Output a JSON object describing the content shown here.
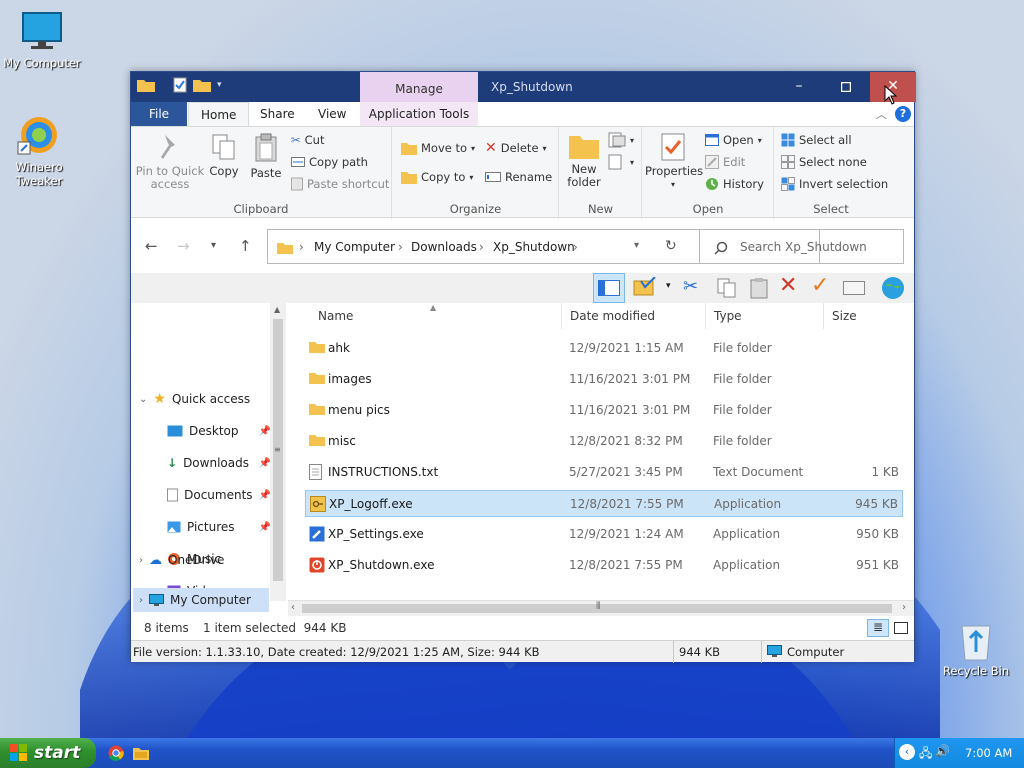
{
  "desktop": {
    "icons": [
      {
        "label": "My Computer"
      },
      {
        "label": "Winaero Tweaker"
      },
      {
        "label": "Recycle Bin"
      }
    ]
  },
  "window": {
    "title": "Xp_Shutdown",
    "context_tab": "Manage",
    "tabs": [
      "File",
      "Home",
      "Share",
      "View",
      "Application Tools"
    ],
    "ribbon": {
      "clipboard": {
        "label": "Clipboard",
        "pin": "Pin to Quick access",
        "copy": "Copy",
        "paste": "Paste",
        "cut": "Cut",
        "copy_path": "Copy path",
        "paste_shortcut": "Paste shortcut"
      },
      "organize": {
        "label": "Organize",
        "move_to": "Move to",
        "copy_to": "Copy to",
        "delete": "Delete",
        "rename": "Rename"
      },
      "new": {
        "label": "New",
        "new_folder": "New folder"
      },
      "open": {
        "label": "Open",
        "properties": "Properties",
        "open": "Open",
        "edit": "Edit",
        "history": "History"
      },
      "select": {
        "label": "Select",
        "select_all": "Select all",
        "select_none": "Select none",
        "invert": "Invert selection"
      }
    },
    "breadcrumb": [
      "My Computer",
      "Downloads",
      "Xp_Shutdown"
    ],
    "search_placeholder": "Search Xp_Shutdown",
    "nav": {
      "quick_access": "Quick access",
      "items": [
        "Desktop",
        "Downloads",
        "Documents",
        "Pictures",
        "Music",
        "Videos"
      ],
      "onedrive": "OneDrive",
      "my_computer": "My Computer"
    },
    "columns": [
      "Name",
      "Date modified",
      "Type",
      "Size"
    ],
    "files": [
      {
        "name": "ahk",
        "date": "12/9/2021 1:15 AM",
        "type": "File folder",
        "size": "",
        "icon": "folder-icon"
      },
      {
        "name": "images",
        "date": "11/16/2021 3:01 PM",
        "type": "File folder",
        "size": "",
        "icon": "folder-icon"
      },
      {
        "name": "menu pics",
        "date": "11/16/2021 3:01 PM",
        "type": "File folder",
        "size": "",
        "icon": "folder-icon"
      },
      {
        "name": "misc",
        "date": "12/8/2021 8:32 PM",
        "type": "File folder",
        "size": "",
        "icon": "folder-icon"
      },
      {
        "name": "INSTRUCTIONS.txt",
        "date": "5/27/2021 3:45 PM",
        "type": "Text Document",
        "size": "1 KB",
        "icon": "text-file-icon"
      },
      {
        "name": "XP_Logoff.exe",
        "date": "12/8/2021 7:55 PM",
        "type": "Application",
        "size": "945 KB",
        "icon": "key-exe-icon"
      },
      {
        "name": "XP_Settings.exe",
        "date": "12/9/2021 1:24 AM",
        "type": "Application",
        "size": "950 KB",
        "icon": "wrench-exe-icon"
      },
      {
        "name": "XP_Shutdown.exe",
        "date": "12/8/2021 7:55 PM",
        "type": "Application",
        "size": "951 KB",
        "icon": "power-exe-icon"
      }
    ],
    "status": {
      "count": "8 items",
      "selection": "1 item selected  944 KB"
    },
    "info": {
      "details": "File version: 1.1.33.10, Date created: 12/9/2021 1:25 AM, Size: 944 KB",
      "size": "944 KB",
      "location": "Computer"
    }
  },
  "taskbar": {
    "start": "start",
    "clock": "7:00 AM"
  }
}
